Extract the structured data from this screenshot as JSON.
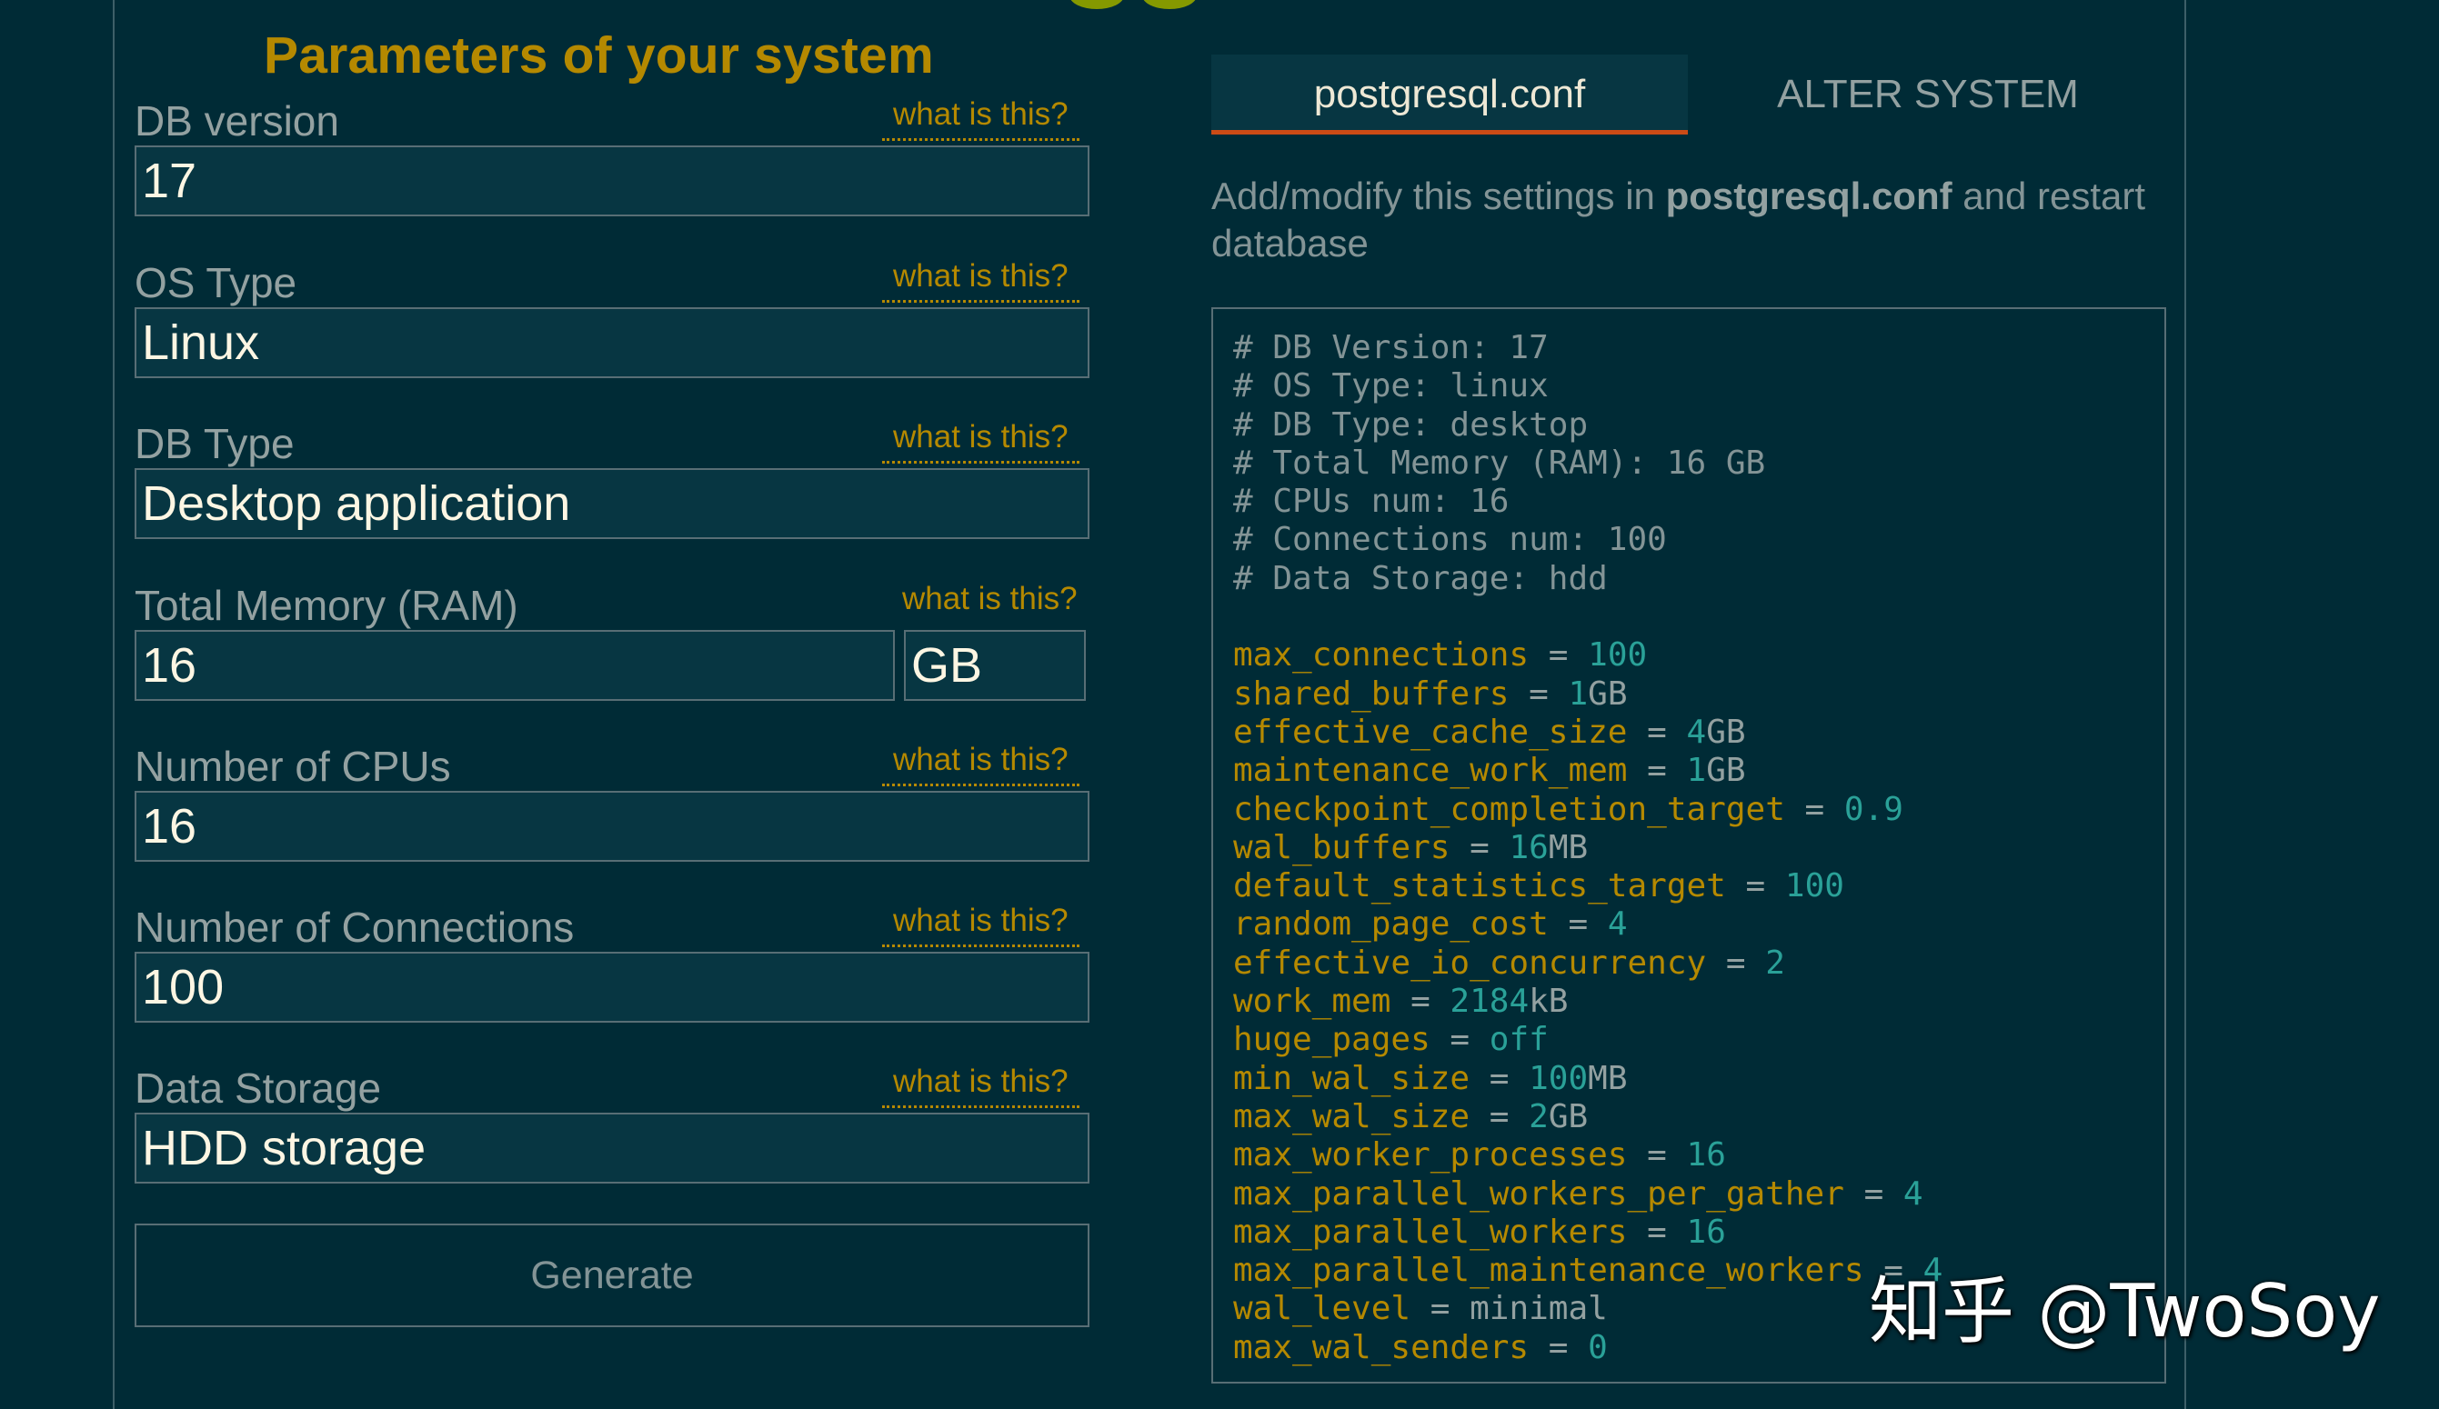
{
  "left": {
    "title": "Parameters of your system",
    "help_link": "what is this?",
    "fields": [
      {
        "label": "DB version",
        "value": "17"
      },
      {
        "label": "OS Type",
        "value": "Linux"
      },
      {
        "label": "DB Type",
        "value": "Desktop application"
      },
      {
        "label": "Total Memory (RAM)",
        "value": "16",
        "unit": "GB"
      },
      {
        "label": "Number of CPUs",
        "value": "16"
      },
      {
        "label": "Number of Connections",
        "value": "100"
      },
      {
        "label": "Data Storage",
        "value": "HDD storage"
      }
    ],
    "generate_label": "Generate"
  },
  "right": {
    "tabs": [
      "postgresql.conf",
      "ALTER SYSTEM"
    ],
    "active_tab": "postgresql.conf",
    "intro_pre": "Add/modify this settings in ",
    "intro_bold": "postgresql.conf",
    "intro_post": " and restart database",
    "comments": [
      "# DB Version: 17",
      "# OS Type: linux",
      "# DB Type: desktop",
      "# Total Memory (RAM): 16 GB",
      "# CPUs num: 16",
      "# Connections num: 100",
      "# Data Storage: hdd"
    ],
    "settings": [
      {
        "key": "max_connections",
        "num": "100",
        "unit": ""
      },
      {
        "key": "shared_buffers",
        "num": "1",
        "unit": "GB"
      },
      {
        "key": "effective_cache_size",
        "num": "4",
        "unit": "GB"
      },
      {
        "key": "maintenance_work_mem",
        "num": "1",
        "unit": "GB"
      },
      {
        "key": "checkpoint_completion_target",
        "num": "0.9",
        "unit": ""
      },
      {
        "key": "wal_buffers",
        "num": "16",
        "unit": "MB"
      },
      {
        "key": "default_statistics_target",
        "num": "100",
        "unit": ""
      },
      {
        "key": "random_page_cost",
        "num": "4",
        "unit": ""
      },
      {
        "key": "effective_io_concurrency",
        "num": "2",
        "unit": ""
      },
      {
        "key": "work_mem",
        "num": "2184",
        "unit": "kB"
      },
      {
        "key": "huge_pages",
        "num": "off",
        "unit": ""
      },
      {
        "key": "min_wal_size",
        "num": "100",
        "unit": "MB"
      },
      {
        "key": "max_wal_size",
        "num": "2",
        "unit": "GB"
      },
      {
        "key": "max_worker_processes",
        "num": "16",
        "unit": ""
      },
      {
        "key": "max_parallel_workers_per_gather",
        "num": "4",
        "unit": ""
      },
      {
        "key": "max_parallel_workers",
        "num": "16",
        "unit": ""
      },
      {
        "key": "max_parallel_maintenance_workers",
        "num": "4",
        "unit": ""
      },
      {
        "key": "wal_level",
        "num": "",
        "unit": "minimal"
      },
      {
        "key": "max_wal_senders",
        "num": "0",
        "unit": ""
      }
    ]
  },
  "watermark": "知乎 @TwoSoy",
  "colors": {
    "background": "#002b36",
    "accent": "#b58900",
    "tab_underline": "#cb4b16"
  }
}
